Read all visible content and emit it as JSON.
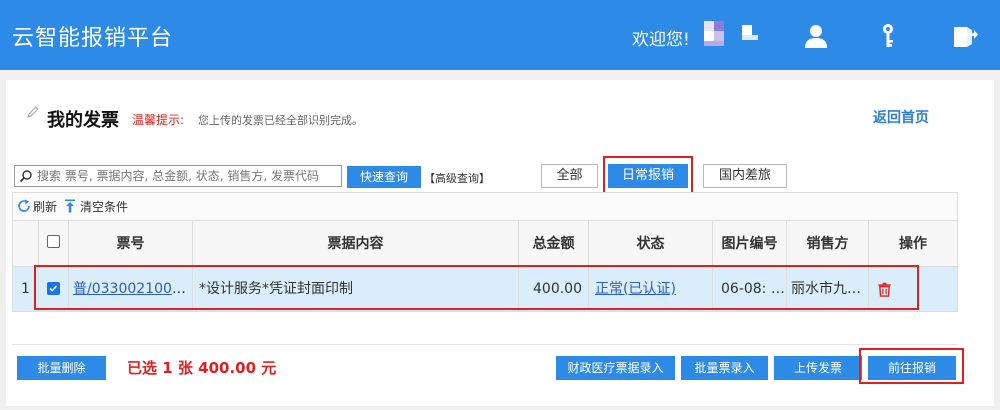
{
  "header": {
    "app_title": "云智能报销平台",
    "welcome": "欢迎您!",
    "icons": [
      "user-icon",
      "key-icon",
      "logout-icon"
    ],
    "brand_color": "#2d8ae6"
  },
  "page": {
    "title": "我的发票",
    "tip_label": "温馨提示:",
    "tip_text": "您上传的发票已经全部识别完成。",
    "home_link": "返回首页"
  },
  "search": {
    "placeholder": "搜索 票号, 票据内容, 总金额, 状态, 销售方, 发票代码",
    "value": "",
    "quick_button": "快速查询",
    "advanced_link": "【高级查询】"
  },
  "tabs": [
    {
      "label": "全部",
      "active": false
    },
    {
      "label": "日常报销",
      "active": true
    },
    {
      "label": "国内差旅",
      "active": false
    }
  ],
  "toolbar": {
    "refresh": "刷新",
    "clear": "清空条件"
  },
  "table": {
    "columns": [
      "票号",
      "票据内容",
      "总金额",
      "状态",
      "图片编号",
      "销售方",
      "操作"
    ],
    "rows": [
      {
        "index": "1",
        "checked": true,
        "ticket_no": "普/0330021003…",
        "content": "*设计服务*凭证封面印制",
        "amount": "400.00",
        "status": "正常(已认证)",
        "image_no": "06-08: …",
        "seller": "丽水市九…"
      }
    ]
  },
  "footer": {
    "batch_delete": "批量删除",
    "selected_prefix": "已选",
    "selected_count": "1",
    "selected_unit": "张",
    "selected_amount": "400.00",
    "selected_currency": "元",
    "medical_entry": "财政医疗票据录入",
    "batch_entry": "批量票录入",
    "upload": "上传发票",
    "go_reimburse": "前往报销"
  },
  "colors": {
    "accent": "#2d8ae6",
    "highlight_red": "#e02020",
    "selected_row": "#d9edfb"
  }
}
